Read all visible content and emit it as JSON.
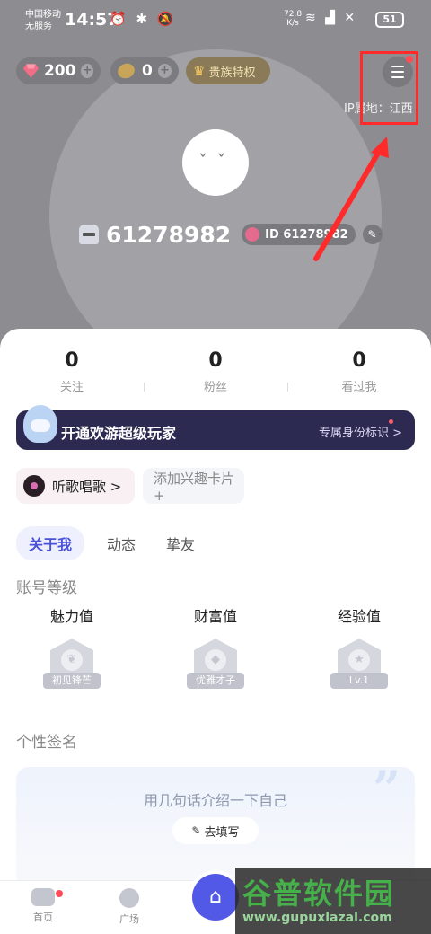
{
  "status_bar": {
    "carrier1": "中国移动",
    "carrier2": "无服务",
    "time": "14:57",
    "net_speed": "72.8",
    "net_unit": "K/s",
    "battery": "51"
  },
  "wallet": {
    "diamonds": "200",
    "beans": "0",
    "noble_label": "贵族特权"
  },
  "ip_location": "IP属地：江西",
  "profile": {
    "name": "61278982",
    "id_label": "ID 61278982"
  },
  "stats": [
    {
      "value": "0",
      "label": "关注"
    },
    {
      "value": "0",
      "label": "粉丝"
    },
    {
      "value": "0",
      "label": "看过我"
    }
  ],
  "vip_banner": {
    "title": "开通欢游超级玩家",
    "subtitle": "专属身份标识 >"
  },
  "chips": {
    "song": "听歌唱歌 >",
    "add_interest": "添加兴趣卡片 +"
  },
  "tabs": [
    "关于我",
    "动态",
    "挚友"
  ],
  "account_level": {
    "title": "账号等级",
    "items": [
      {
        "label": "魅力值",
        "badge": "初见锋芒"
      },
      {
        "label": "财富值",
        "badge": "优雅才子"
      },
      {
        "label": "经验值",
        "badge": "Lv.1"
      }
    ]
  },
  "signature": {
    "title": "个性签名",
    "placeholder": "用几句话介绍一下自己",
    "button": "去填写"
  },
  "nav": {
    "home": "首页",
    "square": "广场"
  },
  "watermark": {
    "cn": "谷普软件园",
    "en": "www.gupuxlazal.com"
  },
  "colors": {
    "accent": "#5259e6",
    "annotation": "#ff2a2a",
    "vip_bg": "#2d2a52"
  }
}
